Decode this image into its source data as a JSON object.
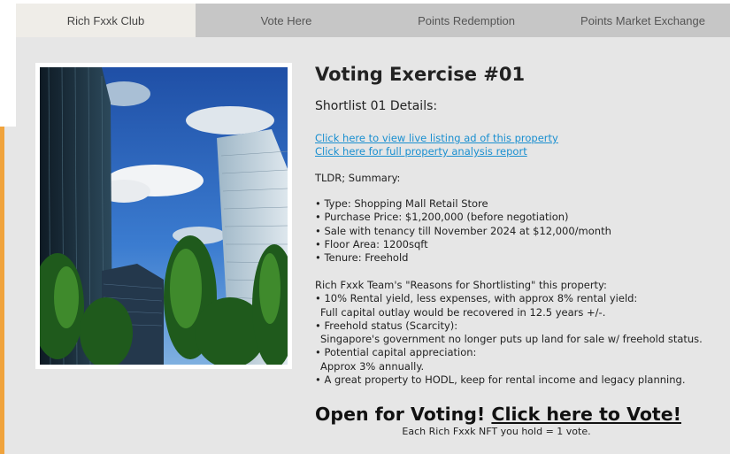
{
  "nav": {
    "tabs": [
      {
        "label": "Rich Fxxk Club",
        "active": true
      },
      {
        "label": "Vote Here",
        "active": false
      },
      {
        "label": "Points Redemption",
        "active": false
      },
      {
        "label": "Points Market Exchange",
        "active": false
      }
    ]
  },
  "colors": {
    "accent_strip": "#f0a33c",
    "nav_background": "#c6c6c6",
    "active_tab": "#efede8",
    "page_background": "#e6e6e6",
    "link": "#1a8fd0"
  },
  "main": {
    "title": "Voting Exercise #01",
    "subtitle": "Shortlist 01 Details:",
    "links": [
      "Click here to view live listing ad of this property",
      "Click here for full property analysis report"
    ],
    "tldr": "TLDR; Summary:",
    "summary": [
      "• Type: Shopping Mall Retail Store",
      "• Purchase Price: $1,200,000 (before negotiation)",
      "• Sale with tenancy till November 2024 at $12,000/month",
      "• Floor Area: 1200sqft",
      "• Tenure: Freehold"
    ],
    "reasons_heading": "Rich Fxxk Team's \"Reasons for Shortlisting\" this property:",
    "reasons": [
      "• 10% Rental yield, less expenses, with approx 8% rental yield:",
      "  Full capital outlay would be recovered in 12.5 years +/-.",
      "• Freehold status (Scarcity):",
      "  Singapore's government no longer puts up land for sale w/ freehold status.",
      "• Potential capital appreciation:",
      "  Approx 3% annually.",
      "• A great property to HODL, keep for rental income and legacy planning."
    ],
    "vote_prefix": "Open for Voting!",
    "vote_link": "Click here to Vote!",
    "vote_note": "Each Rich Fxxk NFT you hold = 1 vote."
  }
}
